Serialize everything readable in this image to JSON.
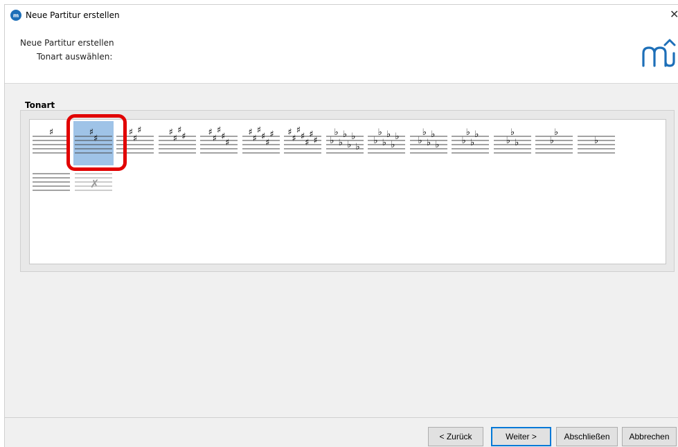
{
  "window": {
    "title": "Neue Partitur erstellen"
  },
  "header": {
    "title": "Neue Partitur erstellen",
    "subtitle": "Tonart auswählen:",
    "logo_icon": "musescore-logo-icon"
  },
  "key_group": {
    "label": "Tonart",
    "selected_index": 1,
    "keys": [
      {
        "symbol": "sharp",
        "count": 1
      },
      {
        "symbol": "sharp",
        "count": 2
      },
      {
        "symbol": "sharp",
        "count": 3
      },
      {
        "symbol": "sharp",
        "count": 4
      },
      {
        "symbol": "sharp",
        "count": 5
      },
      {
        "symbol": "sharp",
        "count": 6
      },
      {
        "symbol": "sharp",
        "count": 7
      },
      {
        "symbol": "flat",
        "count": 7
      },
      {
        "symbol": "flat",
        "count": 6
      },
      {
        "symbol": "flat",
        "count": 5
      },
      {
        "symbol": "flat",
        "count": 4
      },
      {
        "symbol": "flat",
        "count": 3
      },
      {
        "symbol": "flat",
        "count": 2
      },
      {
        "symbol": "flat",
        "count": 1
      },
      {
        "symbol": "none",
        "count": 0
      },
      {
        "symbol": "atonal",
        "count": 0
      }
    ]
  },
  "buttons": {
    "back": "< Zurück",
    "next": "Weiter >",
    "finish": "Abschließen",
    "cancel": "Abbrechen"
  },
  "colors": {
    "selection": "#9fc3e7",
    "highlight": "#e10000",
    "accent": "#0078d7"
  }
}
